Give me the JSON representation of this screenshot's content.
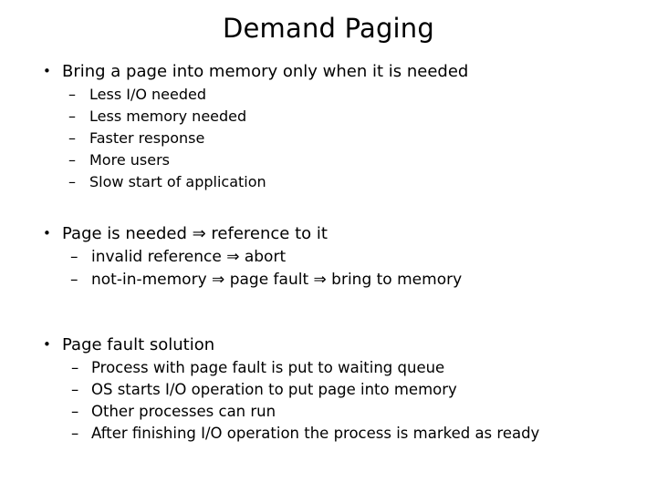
{
  "slide": {
    "title": "Demand Paging",
    "sections": [
      {
        "id": "demand-paging-intro",
        "bullet_marker": "•",
        "heading": "Bring a page into memory only when it is needed",
        "sub_marker": "–",
        "items": [
          "Less I/O needed",
          "Less memory needed",
          "Faster response",
          "More users",
          "Slow start of application"
        ]
      },
      {
        "id": "page-is-needed",
        "bullet_marker": "•",
        "heading": "Page is needed ⇒ reference to it",
        "sub_marker": "–",
        "items": [
          "invalid reference ⇒ abort",
          "not-in-memory ⇒ page fault ⇒ bring to memory"
        ]
      },
      {
        "id": "page-fault-solution",
        "bullet_marker": "•",
        "heading": "Page fault solution",
        "sub_marker": "–",
        "items": [
          "Process with page fault is put to waiting queue",
          "OS starts I/O operation to put page into memory",
          "Other processes can run",
          "After finishing I/O operation the process is marked as ready"
        ]
      }
    ]
  },
  "colors": {
    "background": "#ffffff",
    "text": "#000000"
  }
}
